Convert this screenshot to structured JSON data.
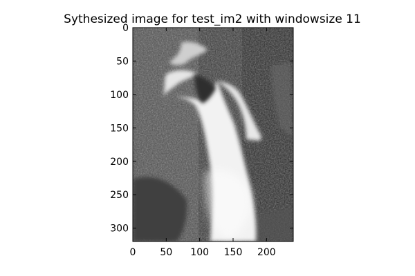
{
  "chart_data": {
    "type": "image",
    "title": "Sythesized image for test_im2 with windowsize 11",
    "xlabel": "",
    "ylabel": "",
    "colormap": "gray",
    "image_extent": {
      "width": 240,
      "height": 320
    },
    "xlim": [
      0,
      240
    ],
    "ylim": [
      320,
      0
    ],
    "xticks": [
      0,
      50,
      100,
      150,
      200
    ],
    "yticks": [
      0,
      50,
      100,
      150,
      200,
      250,
      300
    ],
    "grid": false
  }
}
